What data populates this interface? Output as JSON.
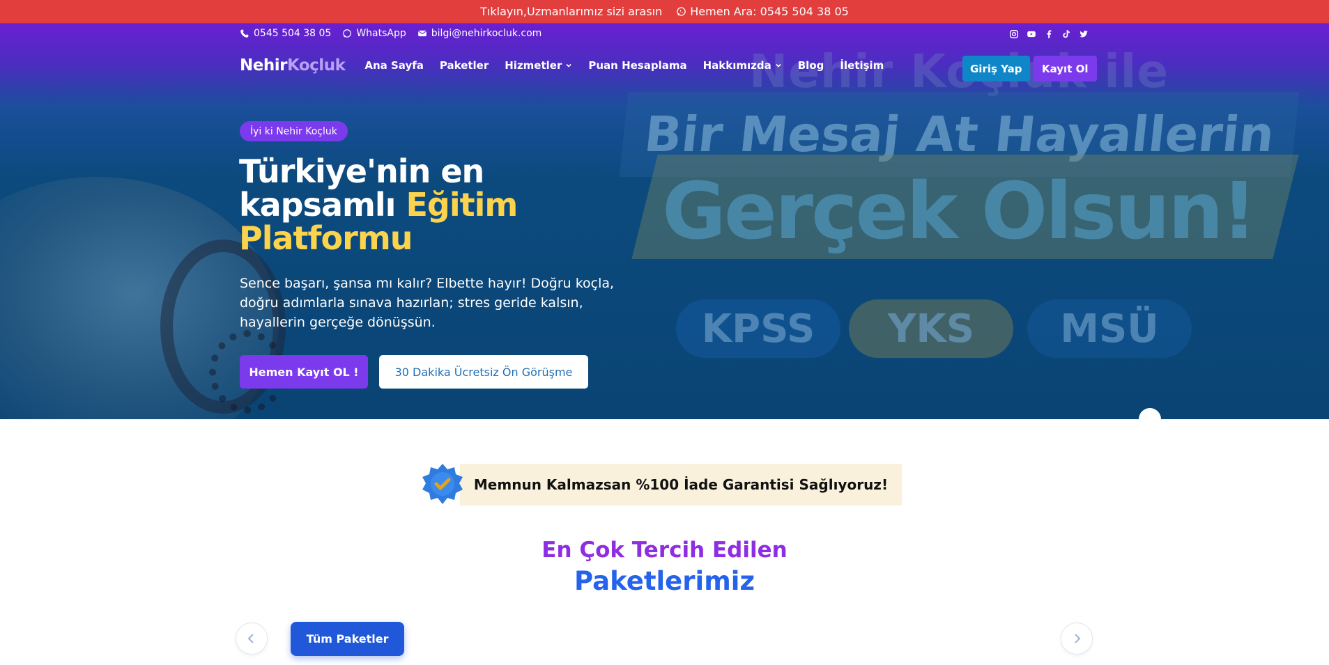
{
  "announcement": {
    "text": "Tıklayın,Uzmanlarımız sizi arasın",
    "call_text": "Hemen Ara: 0545 504 38 05",
    "bg_color": "#e23e3e"
  },
  "contact": {
    "phone": "0545 504 38 05",
    "whatsapp": "WhatsApp",
    "email": "bilgi@nehirkocluk.com"
  },
  "socials": [
    "instagram-icon",
    "youtube-icon",
    "facebook-icon",
    "tiktok-icon",
    "twitter-icon"
  ],
  "logo": {
    "part1": "Nehir",
    "part2": "Koçluk"
  },
  "nav": {
    "items": [
      {
        "label": "Ana Sayfa"
      },
      {
        "label": "Paketler"
      },
      {
        "label": "Hizmetler"
      },
      {
        "label": "Puan Hesaplama"
      },
      {
        "label": "Hakkımızda"
      },
      {
        "label": "Blog"
      },
      {
        "label": "İletişim"
      }
    ],
    "login": "Giriş Yap",
    "register": "Kayıt Ol"
  },
  "hero": {
    "badge": "İyi ki Nehir Koçluk",
    "headline_part1": "Türkiye'nin en kapsamlı ",
    "headline_highlight": "Eğitim Platformu",
    "lead": "Sence başarı, şansa mı kalır? Elbette hayır! Doğru koçla, doğru adımlarla sınava hazırlan; stres geride kalsın, hayallerin gerçeğe dönüşsün.",
    "cta_primary": "Hemen Kayıt OL !",
    "cta_secondary": "30 Dakika Ücretsiz Ön Görüşme",
    "background": {
      "line1": "Nehir Koçluk ile",
      "line2": "Bir Mesaj At Hayallerin",
      "line3": "Gerçek Olsun!",
      "pills": [
        "KPSS",
        "YKS",
        "MSÜ"
      ]
    }
  },
  "guarantee": {
    "text": "Memnun Kalmazsan %100 İade Garantisi Sağlıyoruz!"
  },
  "packages": {
    "title_line1": "En Çok Tercih Edilen",
    "title_line2": "Paketlerimiz",
    "all_button": "Tüm Paketler"
  },
  "colors": {
    "accent_purple": "#7c3aed",
    "accent_yellow": "#fcd34d",
    "accent_blue": "#2563eb",
    "login_blue": "#0f86c8"
  }
}
